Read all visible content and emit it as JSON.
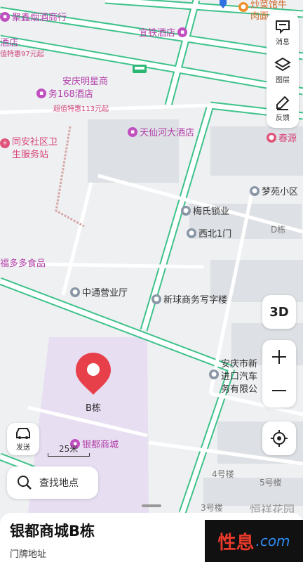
{
  "pois": [
    {
      "id": "jujin",
      "label": "聚鑫烟酒商行",
      "kind": "hotel"
    },
    {
      "id": "yitie",
      "label": "宜铁酒店",
      "kind": "hotel"
    },
    {
      "id": "jiudian",
      "label": "酒店",
      "kind": "hotel"
    },
    {
      "id": "mingxing",
      "label": "安庆明星商",
      "label2": "务168酒店",
      "kind": "hotel"
    },
    {
      "id": "tianxian",
      "label": "天仙河大酒店",
      "kind": "hotel"
    },
    {
      "id": "tongan",
      "label": "同安社区卫",
      "label2": "生服务站",
      "kind": "pink"
    },
    {
      "id": "chunyuan",
      "label": "春源",
      "kind": "pink"
    },
    {
      "id": "chaocai",
      "label": "炒菜馆牛",
      "label2": "肉面",
      "kind": "food"
    },
    {
      "id": "mengyuan",
      "label": "梦苑小区",
      "kind": "gray"
    },
    {
      "id": "meishi",
      "label": "梅氏锁业",
      "kind": "gray"
    },
    {
      "id": "xibei",
      "label": "西北1门",
      "kind": "gray"
    },
    {
      "id": "fuduoduo",
      "label": "福多多食品",
      "kind": "hotel"
    },
    {
      "id": "zhongtong",
      "label": "中通营业厅",
      "kind": "gray"
    },
    {
      "id": "xinqiu",
      "label": "新球商务写字楼",
      "kind": "gray"
    },
    {
      "id": "xinjinkou",
      "label": "安庆市新",
      "label2": "进口汽车",
      "label3": "务有限公",
      "kind": "gray"
    },
    {
      "id": "yindu",
      "label": "银都商城",
      "kind": "hotel"
    }
  ],
  "promos": {
    "p1": "值特惠97元起",
    "p2": "超值特惠113元起"
  },
  "buildings": {
    "d": "D栋",
    "b4": "4号楼",
    "b5": "5号楼",
    "b3": "3号楼",
    "hx": "恒祥花园"
  },
  "marker": {
    "label": "B栋"
  },
  "controls": {
    "messages": "消息",
    "layers": "图层",
    "feedback": "反馈",
    "three_d": "3D",
    "send": "发送"
  },
  "scale": {
    "label": "25米"
  },
  "search": {
    "placeholder": "查找地点"
  },
  "place": {
    "title": "银都商城B栋",
    "subtitle": "门牌地址"
  },
  "watermark": {
    "cn": "性息",
    "en": ".com"
  },
  "colors": {
    "road_edge": "#3ec28a",
    "road": "#ffffff",
    "campus": "#e7def2",
    "marker": "#e8404a"
  }
}
